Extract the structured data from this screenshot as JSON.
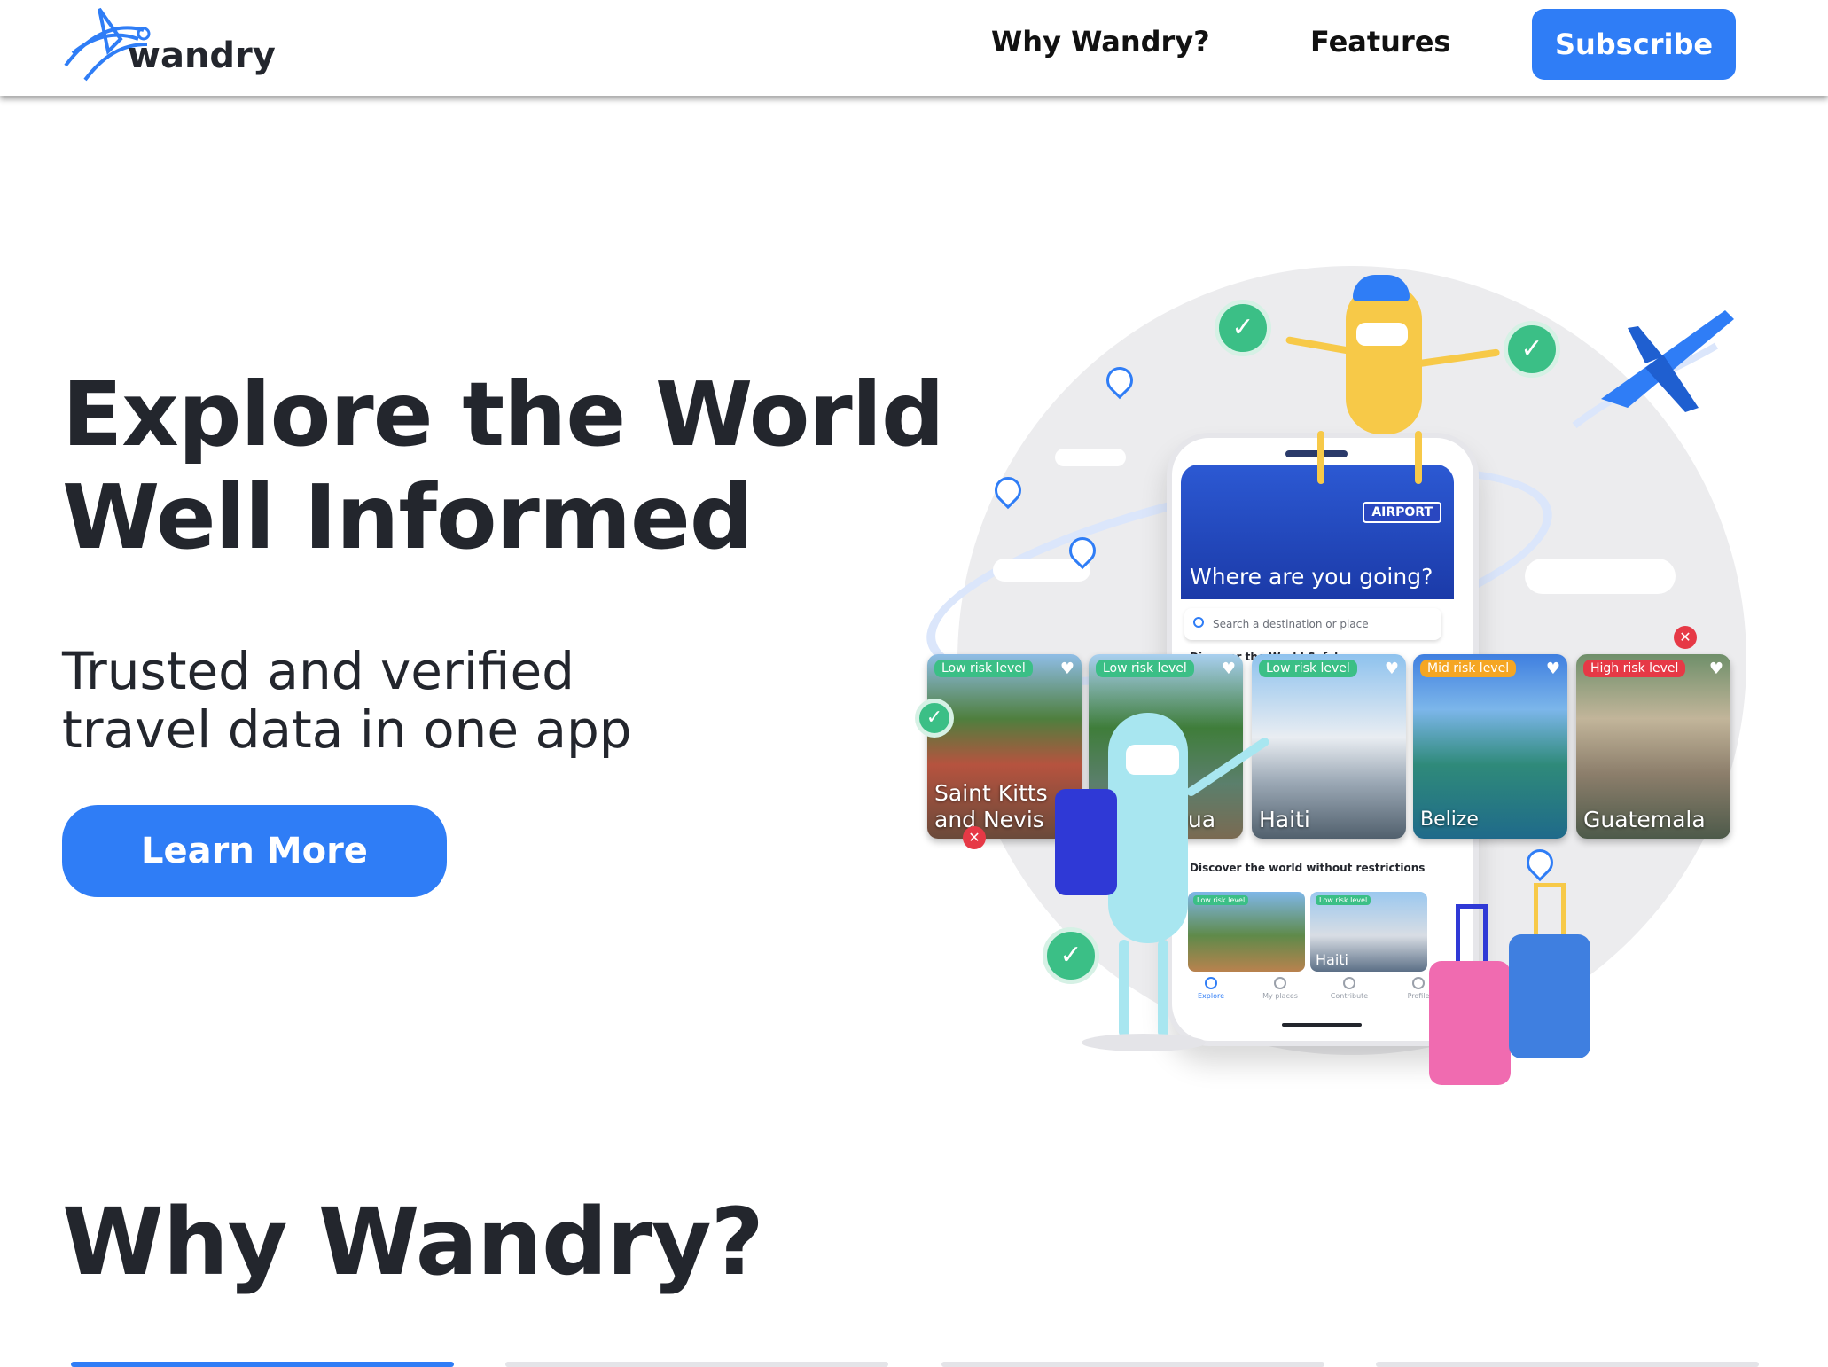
{
  "header": {
    "logo_text": "wandry",
    "nav": [
      {
        "label": "Why Wandry?"
      },
      {
        "label": "Features"
      }
    ],
    "subscribe_label": "Subscribe"
  },
  "hero": {
    "title_line1": "Explore the World",
    "title_line2": "Well Informed",
    "subtitle_line1": "Trusted and verified",
    "subtitle_line2": "travel data in one app",
    "cta_label": "Learn More"
  },
  "illustration": {
    "phone": {
      "airport_sign": "AIRPORT",
      "heading": "Where are you going?",
      "search_placeholder": "Search a destination or place",
      "section1": "Discover the World Safely",
      "section2": "Discover the world without restrictions",
      "mini_cards": [
        {
          "badge": "Low risk level",
          "name": ""
        },
        {
          "badge": "Low risk level",
          "name": "Haiti"
        }
      ],
      "tabs": [
        "Explore",
        "My places",
        "Contribute",
        "Profile"
      ]
    },
    "cards": [
      {
        "badge": "Low risk level",
        "name": "Saint Kitts and Nevis",
        "badge_color": "#3bbf86"
      },
      {
        "badge": "Low risk level",
        "name": "gua",
        "badge_color": "#3bbf86"
      },
      {
        "badge": "Low risk level",
        "name": "Haiti",
        "badge_color": "#3bbf86"
      },
      {
        "badge": "Mid risk level",
        "name": "Belize",
        "badge_color": "#f5a623"
      },
      {
        "badge": "High risk level",
        "name": "Guatemala",
        "badge_color": "#e63946"
      }
    ]
  },
  "sections": {
    "why_title": "Why Wandry?"
  },
  "colors": {
    "accent": "#2f7df6",
    "text": "#23262d",
    "low_risk": "#3bbf86",
    "mid_risk": "#f5a623",
    "high_risk": "#e63946"
  }
}
